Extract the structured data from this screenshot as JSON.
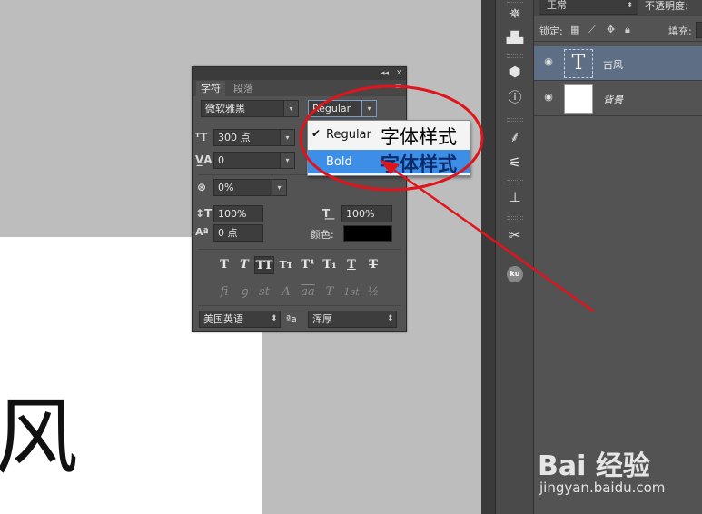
{
  "canvas": {
    "text": "风"
  },
  "layers_panel": {
    "blend_mode": "正常",
    "opacity_label": "不透明度:",
    "lock_label": "锁定:",
    "fill_label": "填充:",
    "layers": [
      {
        "name": "古风",
        "type": "text",
        "thumb_glyph": "T",
        "selected": true
      },
      {
        "name": "背景",
        "type": "background",
        "selected": false
      }
    ]
  },
  "toolbar": {
    "icons": [
      "compass-icon",
      "histogram-icon",
      "3d-cube-icon",
      "info-icon",
      "brush-icon",
      "adjust-sliders-icon",
      "clone-stamp-icon",
      "tools-icon",
      "ku-icon"
    ]
  },
  "character_panel": {
    "tabs": [
      {
        "label": "字符",
        "active": true
      },
      {
        "label": "段落",
        "active": false
      }
    ],
    "font_family": "微软雅黑",
    "font_style": "Regular",
    "font_size": "300 点",
    "kerning": "0",
    "tracking": "0%",
    "vertical_scale": "100%",
    "horizontal_scale": "100%",
    "baseline_shift": "0 点",
    "color_label": "颜色:",
    "color": "#000000",
    "style_buttons": [
      "T",
      "T",
      "TT",
      "Tт",
      "T¹",
      "T₁",
      "T",
      "T"
    ],
    "opentype_buttons": [
      "fi",
      "ꝯ",
      "st",
      "A",
      "aa",
      "T",
      "1st",
      "½"
    ],
    "language": "美国英语",
    "aa_symbol": "ªa",
    "antialias": "浑厚"
  },
  "font_style_dropdown": {
    "options": [
      {
        "label": "Regular",
        "checked": true,
        "note": "字体样式"
      },
      {
        "label": "Bold",
        "checked": false,
        "highlighted": true,
        "note": "字体样式"
      }
    ]
  },
  "annotation": {
    "ellipse_color": "#e0141b",
    "arrow_color": "#e0141b"
  },
  "watermark": {
    "logo": "Bai 经验",
    "url": "jingyan.baidu.com"
  }
}
